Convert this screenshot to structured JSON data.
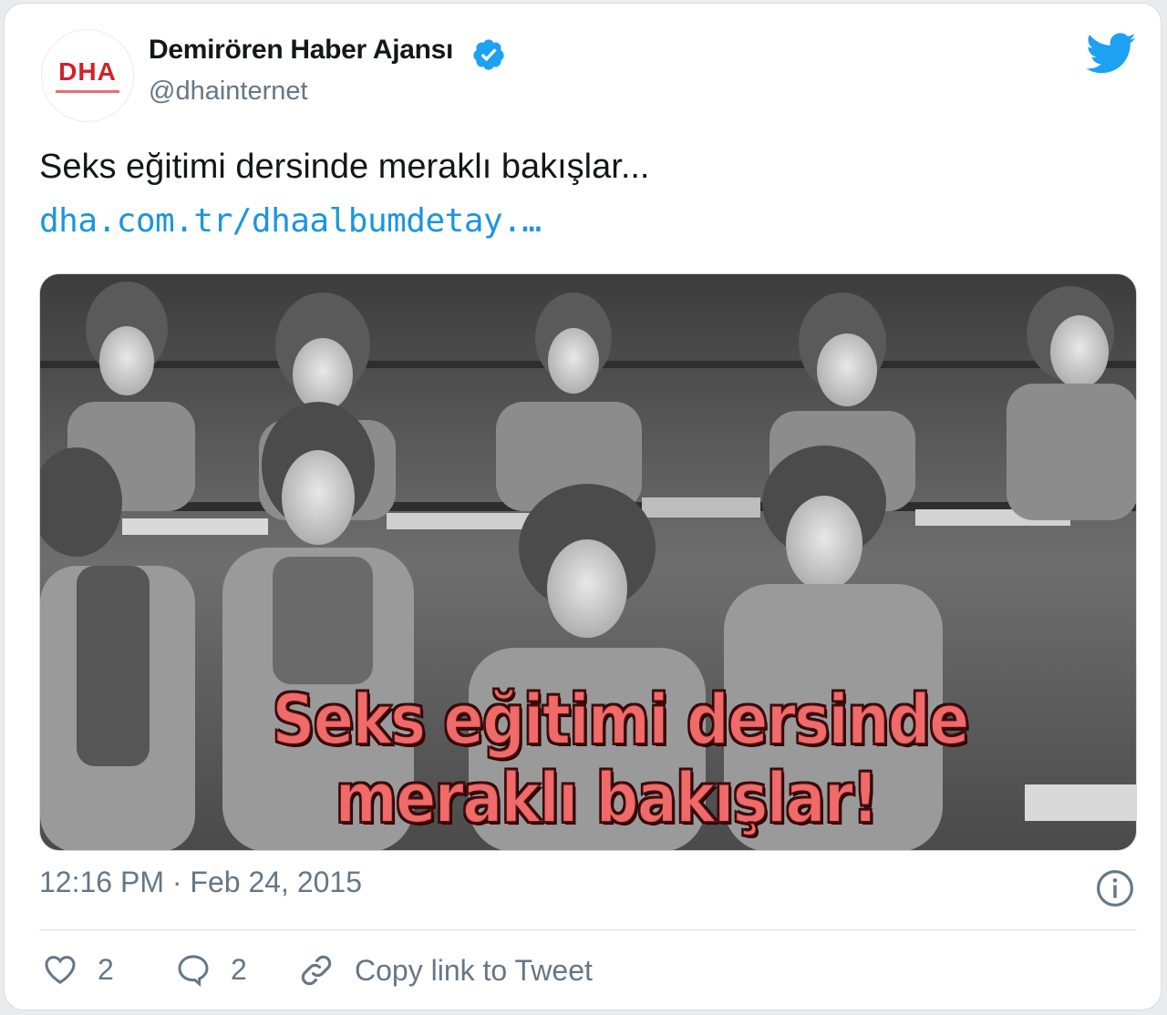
{
  "tweet": {
    "author": {
      "display_name": "Demirören Haber Ajansı",
      "handle": "@dhainternet",
      "verified": true,
      "avatar_text": "DHA"
    },
    "text": "Seks eğitimi dersinde meraklı bakışlar...",
    "link": "dha.com.tr/dhaalbumdetay.…",
    "media": {
      "overlay_line1": "Seks eğitimi dersinde",
      "overlay_line2": "meraklı bakışlar!"
    },
    "timestamp": "12:16 PM · Feb 24, 2015",
    "likes": "2",
    "replies": "2",
    "copy_link_label": "Copy link to Tweet"
  },
  "colors": {
    "accent": "#1da1f2",
    "link": "#1b95e0",
    "secondary_text": "#657786",
    "overlay_text": "#f06a6a",
    "brand_red": "#d4202a"
  },
  "icons": [
    "dha-logo",
    "verified-badge-icon",
    "twitter-bird-icon",
    "info-icon",
    "heart-icon",
    "reply-bubble-icon",
    "link-icon"
  ]
}
